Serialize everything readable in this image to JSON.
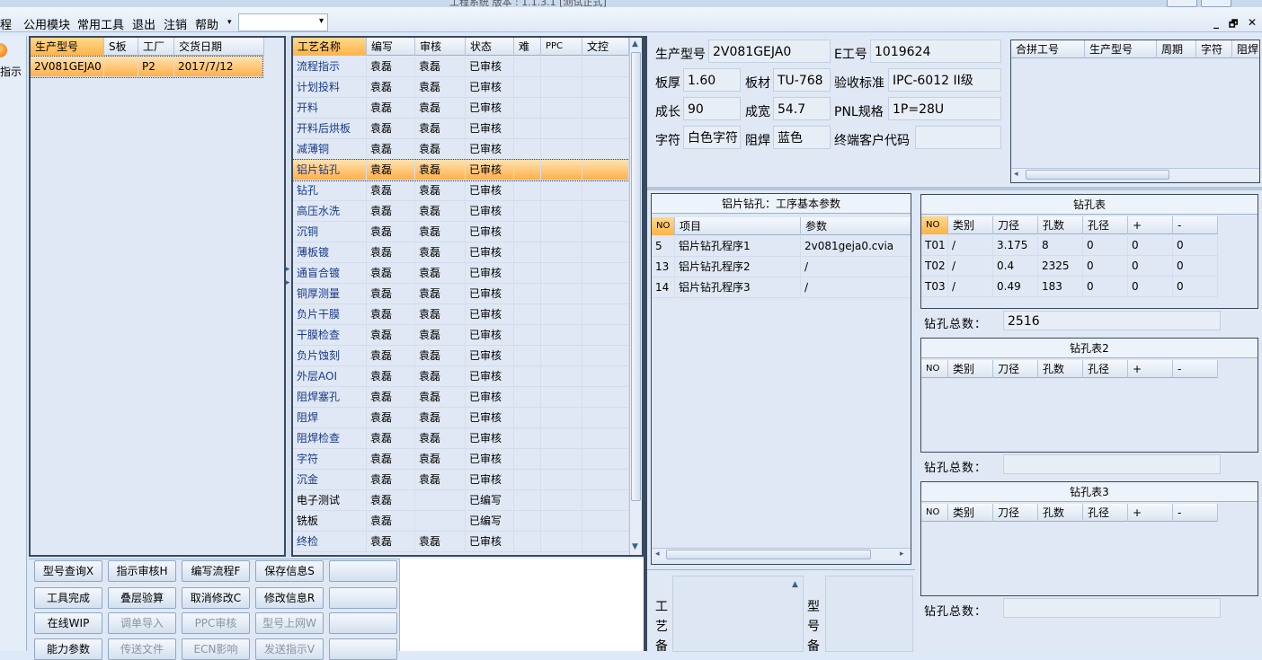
{
  "window": {
    "title_fragment": "工程系统   版本 : 1.1.3.1    [测试正式]"
  },
  "menu": {
    "items": [
      "程",
      "公用模块",
      "常用工具",
      "退出",
      "注销",
      "帮助"
    ],
    "combo_value": ""
  },
  "window_controls": {
    "min": "_",
    "restore": "🗗",
    "close": "✕"
  },
  "left_strip": {
    "label": "指示"
  },
  "products": {
    "headers": [
      "生产型号",
      "S板",
      "工厂",
      "交货日期"
    ],
    "rows": [
      {
        "model": "2V081GEJA0",
        "s": "",
        "factory": "P2",
        "date": "2017/7/12"
      }
    ]
  },
  "process": {
    "headers": [
      "工艺名称",
      "编写",
      "审核",
      "状态",
      "难",
      "PPC",
      "文控"
    ],
    "rows": [
      {
        "name": "流程指示",
        "writer": "袁磊",
        "reviewer": "袁磊",
        "status": "已审核"
      },
      {
        "name": "计划投料",
        "writer": "袁磊",
        "reviewer": "袁磊",
        "status": "已审核"
      },
      {
        "name": "开料",
        "writer": "袁磊",
        "reviewer": "袁磊",
        "status": "已审核"
      },
      {
        "name": "开料后烘板",
        "writer": "袁磊",
        "reviewer": "袁磊",
        "status": "已审核"
      },
      {
        "name": "减薄铜",
        "writer": "袁磊",
        "reviewer": "袁磊",
        "status": "已审核"
      },
      {
        "name": "铝片钻孔",
        "writer": "袁磊",
        "reviewer": "袁磊",
        "status": "已审核"
      },
      {
        "name": "钻孔",
        "writer": "袁磊",
        "reviewer": "袁磊",
        "status": "已审核"
      },
      {
        "name": "高压水洗",
        "writer": "袁磊",
        "reviewer": "袁磊",
        "status": "已审核"
      },
      {
        "name": "沉铜",
        "writer": "袁磊",
        "reviewer": "袁磊",
        "status": "已审核"
      },
      {
        "name": "薄板镀",
        "writer": "袁磊",
        "reviewer": "袁磊",
        "status": "已审核"
      },
      {
        "name": "通盲合镀",
        "writer": "袁磊",
        "reviewer": "袁磊",
        "status": "已审核"
      },
      {
        "name": "铜厚测量",
        "writer": "袁磊",
        "reviewer": "袁磊",
        "status": "已审核"
      },
      {
        "name": "负片干膜",
        "writer": "袁磊",
        "reviewer": "袁磊",
        "status": "已审核"
      },
      {
        "name": "干膜检查",
        "writer": "袁磊",
        "reviewer": "袁磊",
        "status": "已审核"
      },
      {
        "name": "负片蚀刻",
        "writer": "袁磊",
        "reviewer": "袁磊",
        "status": "已审核"
      },
      {
        "name": "外层AOI",
        "writer": "袁磊",
        "reviewer": "袁磊",
        "status": "已审核"
      },
      {
        "name": "阻焊塞孔",
        "writer": "袁磊",
        "reviewer": "袁磊",
        "status": "已审核"
      },
      {
        "name": "阻焊",
        "writer": "袁磊",
        "reviewer": "袁磊",
        "status": "已审核"
      },
      {
        "name": "阻焊检查",
        "writer": "袁磊",
        "reviewer": "袁磊",
        "status": "已审核"
      },
      {
        "name": "字符",
        "writer": "袁磊",
        "reviewer": "袁磊",
        "status": "已审核"
      },
      {
        "name": "沉金",
        "writer": "袁磊",
        "reviewer": "袁磊",
        "status": "已审核"
      },
      {
        "name": "电子测试",
        "writer": "袁磊",
        "reviewer": "",
        "status": "已编写"
      },
      {
        "name": "铣板",
        "writer": "袁磊",
        "reviewer": "",
        "status": "已编写"
      },
      {
        "name": "终检",
        "writer": "袁磊",
        "reviewer": "袁磊",
        "status": "已审核"
      }
    ],
    "selected_row": 5
  },
  "buttons": [
    [
      "型号查询X",
      "指示审核H",
      "编写流程F",
      "保存信息S",
      ""
    ],
    [
      "工具完成",
      "叠层验算",
      "取消修改C",
      "修改信息R",
      ""
    ],
    [
      "在线WIP",
      "调单导入",
      "PPC审核",
      "型号上网W",
      ""
    ],
    [
      "能力参数",
      "传送文件",
      "ECN影响",
      "发送指示V",
      ""
    ]
  ],
  "info": {
    "model_label": "生产型号",
    "model": "2V081GEJA0",
    "e_label": "E工号",
    "e_no": "1019624",
    "thickness_label": "板厚",
    "thickness": "1.60",
    "material_label": "板材",
    "material": "TU-768",
    "standard_label": "验收标准",
    "standard": "IPC-6012 II级",
    "length_label": "成长",
    "length": "90",
    "width_label": "成宽",
    "width": "54.7",
    "pnl_label": "PNL规格",
    "pnl": "1P=28U",
    "char_label": "字符",
    "char": "白色字符",
    "mask_label": "阻焊",
    "mask": "蓝色",
    "customer_label": "终端客户代码",
    "customer": ""
  },
  "merge": {
    "headers": [
      "合拼工号",
      "生产型号",
      "周期",
      "字符",
      "阻焊"
    ]
  },
  "params": {
    "title": "铝片钻孔：工序基本参数",
    "headers": [
      "NO",
      "项目",
      "参数"
    ],
    "rows": [
      {
        "no": "5",
        "item": "铝片钻孔程序1",
        "param": "2v081geja0.cvia"
      },
      {
        "no": "13",
        "item": "铝片钻孔程序2",
        "param": "/"
      },
      {
        "no": "14",
        "item": "铝片钻孔程序3",
        "param": "/"
      }
    ]
  },
  "drill1": {
    "title": "钻孔表",
    "headers": [
      "NO",
      "类别",
      "刀径",
      "孔数",
      "孔径",
      "+",
      "-"
    ],
    "rows": [
      {
        "no": "T01",
        "type": "/",
        "dia": "3.175",
        "count": "8",
        "hole": "0",
        "plus": "0",
        "minus": "0"
      },
      {
        "no": "T02",
        "type": "/",
        "dia": "0.4",
        "count": "2325",
        "hole": "0",
        "plus": "0",
        "minus": "0"
      },
      {
        "no": "T03",
        "type": "/",
        "dia": "0.49",
        "count": "183",
        "hole": "0",
        "plus": "0",
        "minus": "0"
      }
    ],
    "total_label": "钻孔总数：",
    "total": "2516"
  },
  "drill2": {
    "title": "钻孔表2",
    "headers": [
      "NO",
      "类别",
      "刀径",
      "孔数",
      "孔径",
      "+",
      "-"
    ],
    "total_label": "钻孔总数：",
    "total": ""
  },
  "drill3": {
    "title": "钻孔表3",
    "headers": [
      "NO",
      "类别",
      "刀径",
      "孔数",
      "孔径",
      "+",
      "-"
    ],
    "total_label": "钻孔总数：",
    "total": ""
  },
  "notes": {
    "process_label": "工艺备",
    "model_label": "型号备"
  },
  "colors": {
    "selection": "#ffb347",
    "panel_border": "#3a4a5e",
    "background": "#dde9f7"
  }
}
